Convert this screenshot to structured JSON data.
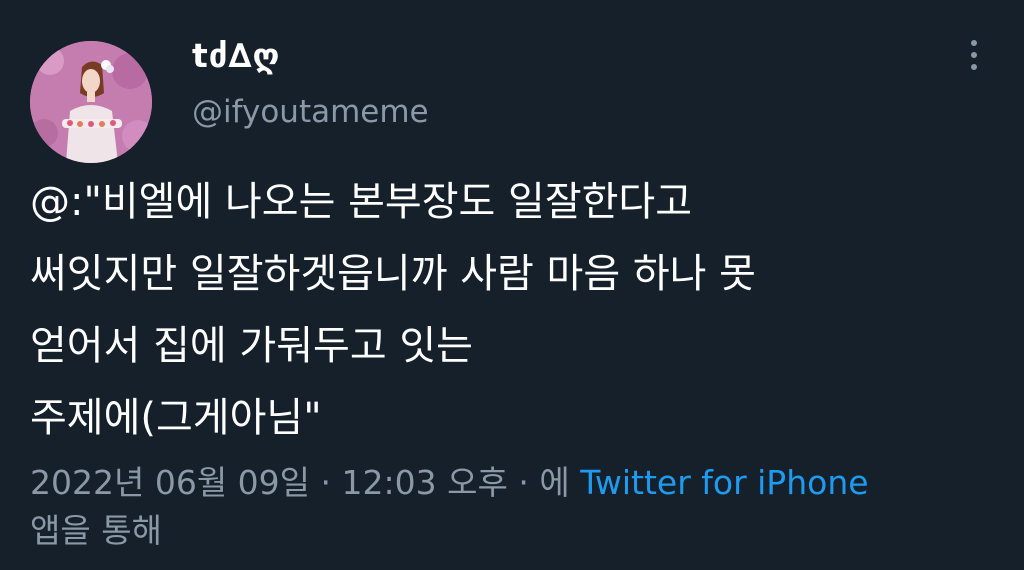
{
  "tweet": {
    "author": {
      "display_name": "tძ∆ღ",
      "handle": "@ifyoutameme"
    },
    "text_lines": [
      "@:\"비엘에 나오는 본부장도 일잘한다고",
      "써잇지만 일잘하겟읍니까 사람 마음 하나 못",
      "얻어서 집에 가둬두고 잇는",
      "주제에(그게아님\""
    ],
    "meta": {
      "date": "2022년 06월 09일",
      "separator": " · ",
      "time": "12:03 오후",
      "via_prefix": "에",
      "source": "Twitter for iPhone",
      "via_suffix": "앱을 통해"
    }
  },
  "icons": {
    "more": "more-vertical-icon"
  },
  "colors": {
    "background": "#15202b",
    "text": "#ffffff",
    "secondary": "#8b98a5",
    "link": "#1d9bf0"
  }
}
